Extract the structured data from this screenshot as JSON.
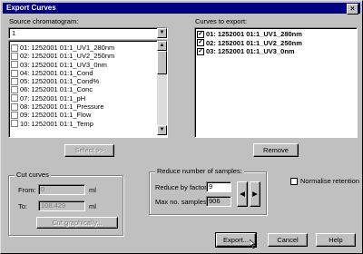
{
  "window": {
    "title": "Export Curves",
    "close_glyph": "×"
  },
  "source": {
    "label": "Source chromatogram:",
    "selected": "1",
    "items": [
      {
        "label": "01: 1252001 01:1_UV1_280nm",
        "checked": false
      },
      {
        "label": "02: 1252001 01:1_UV2_250nm",
        "checked": false
      },
      {
        "label": "03: 1252001 01:1_UV3_0nm",
        "checked": false
      },
      {
        "label": "04: 1252001 01:1_Cond",
        "checked": false
      },
      {
        "label": "05: 1252001 01:1_Cond%",
        "checked": false
      },
      {
        "label": "06: 1252001 01:1_Conc",
        "checked": false
      },
      {
        "label": "07: 1252001 01:1_pH",
        "checked": false
      },
      {
        "label": "08: 1252001 01:1_Pressure",
        "checked": false
      },
      {
        "label": "09: 1252001 01:1_Flow",
        "checked": false
      },
      {
        "label": "10: 1252001 01:1_Temp",
        "checked": false
      }
    ],
    "select_button": "Select >>"
  },
  "export": {
    "label": "Curves to export:",
    "items": [
      {
        "label": "01: 1252001 01:1_UV1_280nm",
        "checked": true
      },
      {
        "label": "02: 1252001 01:1_UV2_250nm",
        "checked": true
      },
      {
        "label": "03: 1252001 01:1_UV3_0nm",
        "checked": true
      }
    ],
    "remove_button": "Remove"
  },
  "cut": {
    "title": "Cut curves",
    "from_label": "From:",
    "from_value": "0",
    "to_label": "To:",
    "to_value": "108.429",
    "unit": "ml",
    "cut_button": "Cut graphically..."
  },
  "reduce": {
    "title": "Reduce number of samples:",
    "factor_label": "Reduce by factor:",
    "factor_value": "9",
    "max_label": "Max no. samples:",
    "max_value": "906"
  },
  "normalise": {
    "label": "Normalise retention",
    "checked": false
  },
  "buttons": {
    "export": "Export...",
    "cancel": "Cancel",
    "help": "Help"
  }
}
